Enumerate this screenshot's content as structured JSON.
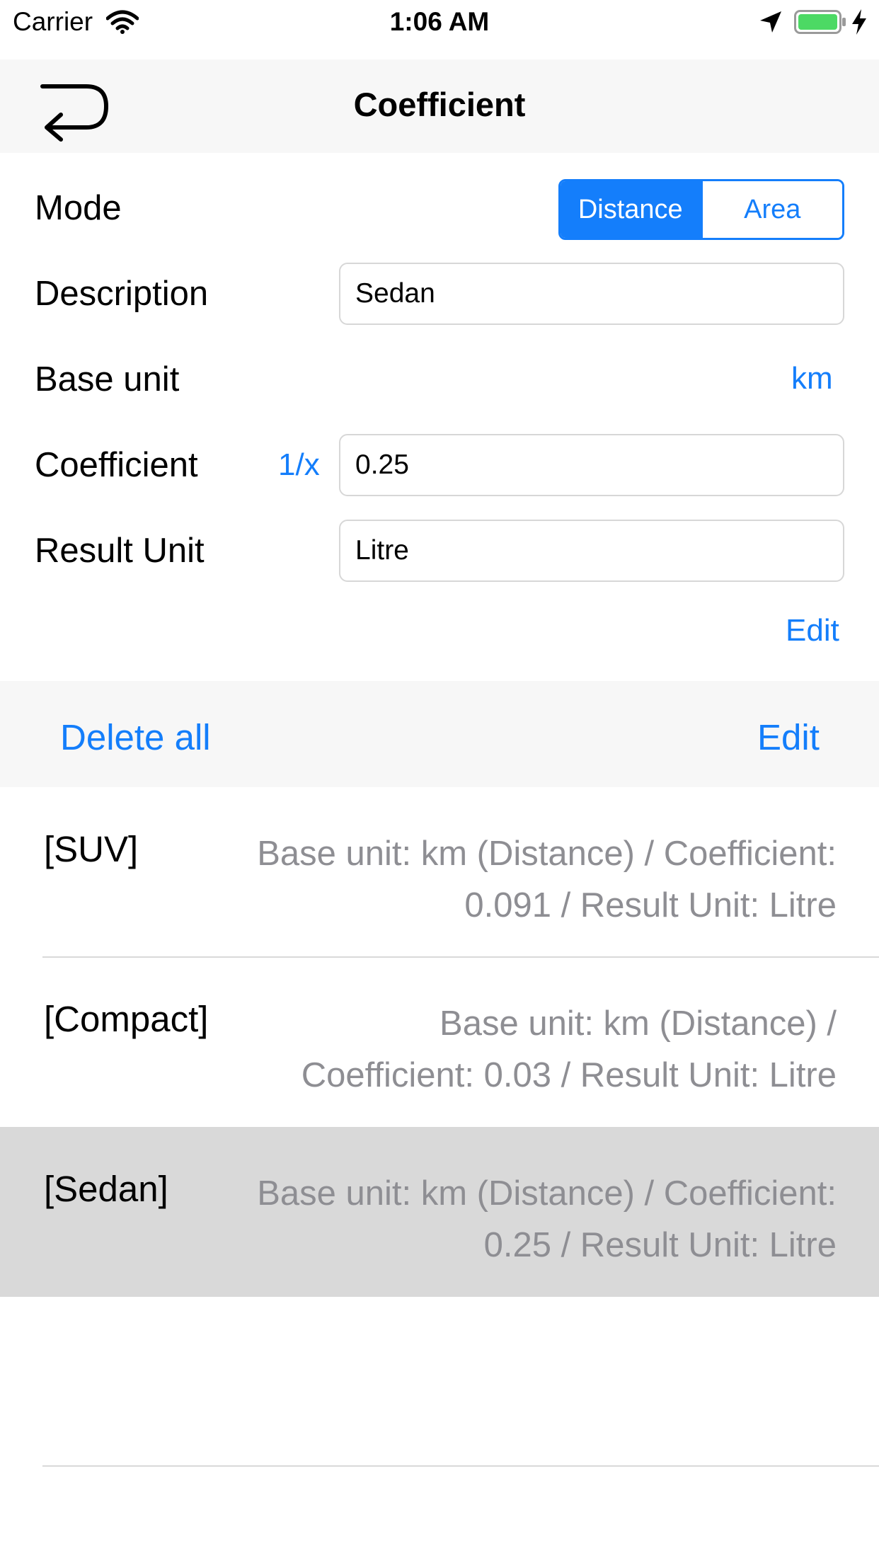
{
  "status_bar": {
    "carrier": "Carrier",
    "time": "1:06 AM",
    "battery_color": "#4cd964"
  },
  "nav": {
    "title": "Coefficient",
    "back_icon": "return-arrow-icon"
  },
  "form": {
    "mode_label": "Mode",
    "mode_options": [
      "Distance",
      "Area"
    ],
    "mode_selected": "Distance",
    "description_label": "Description",
    "description_value": "Sedan",
    "base_unit_label": "Base unit",
    "base_unit_value": "km",
    "coefficient_label": "Coefficient",
    "reciprocal_label": "1/x",
    "coefficient_value": "0.25",
    "result_unit_label": "Result Unit",
    "result_unit_value": "Litre",
    "edit_label": "Edit"
  },
  "toolbar": {
    "delete_all_label": "Delete all",
    "edit_label": "Edit"
  },
  "list": {
    "items": [
      {
        "name": "[SUV]",
        "line1": "Base unit: km (Distance) / Coefficient:",
        "line2": "0.091 / Result Unit: Litre",
        "selected": false
      },
      {
        "name": "[Compact]",
        "line1": "Base unit: km (Distance) /",
        "line2": "Coefficient: 0.03 / Result Unit: Litre",
        "selected": false
      },
      {
        "name": "[Sedan]",
        "line1": "Base unit: km (Distance) / Coefficient:",
        "line2": "0.25 / Result Unit: Litre",
        "selected": true
      }
    ]
  },
  "colors": {
    "accent": "#147efb",
    "secondary_text": "#8e8e93",
    "selected_row": "#d9d9d9"
  }
}
